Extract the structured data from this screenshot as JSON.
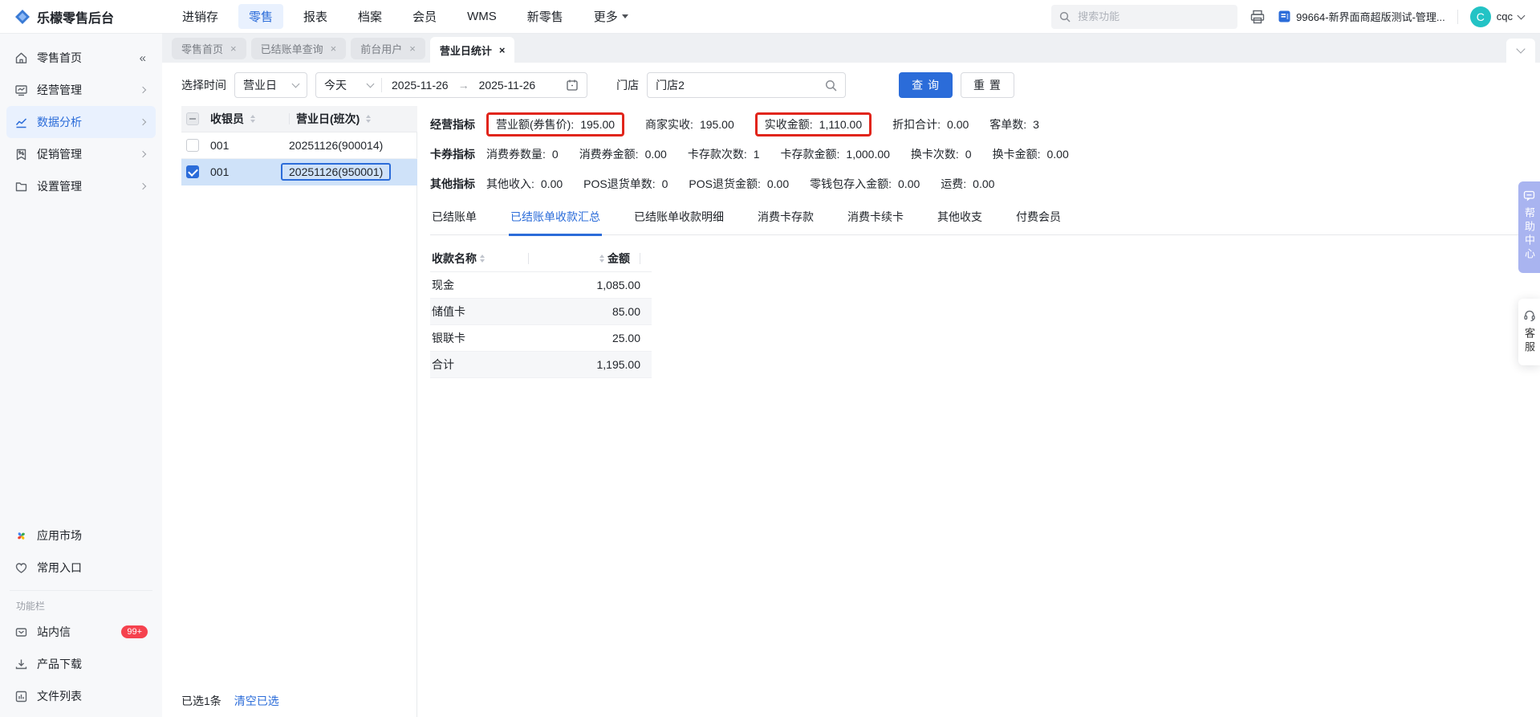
{
  "topbar": {
    "logo_text": "乐檬零售后台",
    "nav": [
      {
        "label": "进销存"
      },
      {
        "label": "零售"
      },
      {
        "label": "报表"
      },
      {
        "label": "档案"
      },
      {
        "label": "会员"
      },
      {
        "label": "WMS"
      },
      {
        "label": "新零售"
      },
      {
        "label": "更多"
      }
    ],
    "search_placeholder": "搜索功能",
    "org_name": "99664-新界面商超版测试-管理...",
    "avatar_letter": "C",
    "username": "cqc"
  },
  "sidebar": {
    "items": [
      {
        "label": "零售首页"
      },
      {
        "label": "经营管理"
      },
      {
        "label": "数据分析"
      },
      {
        "label": "促销管理"
      },
      {
        "label": "设置管理"
      }
    ],
    "secondary": [
      {
        "label": "应用市场"
      },
      {
        "label": "常用入口"
      }
    ],
    "section_label": "功能栏",
    "tools": [
      {
        "label": "站内信",
        "badge": "99+"
      },
      {
        "label": "产品下载"
      },
      {
        "label": "文件列表"
      }
    ]
  },
  "tabs": [
    {
      "label": "零售首页"
    },
    {
      "label": "已结账单查询"
    },
    {
      "label": "前台用户"
    },
    {
      "label": "营业日统计"
    }
  ],
  "filters": {
    "time_label": "选择时间",
    "time_type": "营业日",
    "time_preset": "今天",
    "date_start": "2025-11-26",
    "date_separator": "→",
    "date_end": "2025-11-26",
    "store_label": "门店",
    "store_value": "门店2",
    "query_button": "查 询",
    "reset_button": "重 置"
  },
  "shift_list": {
    "columns": [
      "收银员",
      "营业日(班次)"
    ],
    "rows": [
      {
        "cashier": "001",
        "shift": "20251126(900014)"
      },
      {
        "cashier": "001",
        "shift": "20251126(950001)"
      }
    ],
    "selected_text": "已选1条",
    "clear_link": "清空已选"
  },
  "metrics": {
    "rows": [
      {
        "title": "经营指标",
        "items": [
          {
            "label": "营业额(券售价):",
            "value": "195.00"
          },
          {
            "label": "商家实收:",
            "value": "195.00"
          },
          {
            "label": "实收金额:",
            "value": "1,110.00"
          },
          {
            "label": "折扣合计:",
            "value": "0.00"
          },
          {
            "label": "客单数:",
            "value": "3"
          }
        ]
      },
      {
        "title": "卡券指标",
        "items": [
          {
            "label": "消费券数量:",
            "value": "0"
          },
          {
            "label": "消费券金额:",
            "value": "0.00"
          },
          {
            "label": "卡存款次数:",
            "value": "1"
          },
          {
            "label": "卡存款金额:",
            "value": "1,000.00"
          },
          {
            "label": "换卡次数:",
            "value": "0"
          },
          {
            "label": "换卡金额:",
            "value": "0.00"
          }
        ]
      },
      {
        "title": "其他指标",
        "items": [
          {
            "label": "其他收入:",
            "value": "0.00"
          },
          {
            "label": "POS退货单数:",
            "value": "0"
          },
          {
            "label": "POS退货金额:",
            "value": "0.00"
          },
          {
            "label": "零钱包存入金额:",
            "value": "0.00"
          },
          {
            "label": "运费:",
            "value": "0.00"
          }
        ]
      }
    ]
  },
  "detail_tabs": [
    {
      "label": "已结账单"
    },
    {
      "label": "已结账单收款汇总"
    },
    {
      "label": "已结账单收款明细"
    },
    {
      "label": "消费卡存款"
    },
    {
      "label": "消费卡续卡"
    },
    {
      "label": "其他收支"
    },
    {
      "label": "付费会员"
    }
  ],
  "payment_table": {
    "columns": [
      "收款名称",
      "金额"
    ],
    "rows": [
      {
        "name": "现金",
        "amount": "1,085.00"
      },
      {
        "name": "储值卡",
        "amount": "85.00"
      },
      {
        "name": "银联卡",
        "amount": "25.00"
      },
      {
        "name": "合计",
        "amount": "1,195.00"
      }
    ]
  },
  "floating": {
    "help_center": "帮助中心",
    "customer_service": "客服"
  },
  "colors": {
    "primary": "#2b6cd9",
    "highlight_red": "#e1251b",
    "badge_red": "#f5424e",
    "help_bg": "#a9b4f0",
    "avatar_teal": "#23c3c5"
  }
}
